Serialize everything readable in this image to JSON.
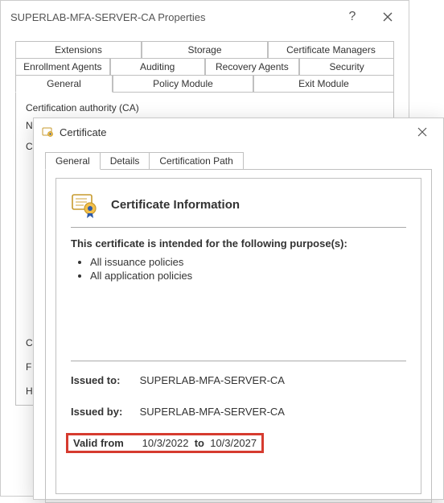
{
  "prop": {
    "title": "SUPERLAB-MFA-SERVER-CA Properties",
    "help": "?",
    "tabs_row1": [
      "Extensions",
      "Storage",
      "Certificate Managers"
    ],
    "tabs_row2": [
      "Enrollment Agents",
      "Auditing",
      "Recovery Agents",
      "Security"
    ],
    "tabs_row3": [
      "General",
      "Policy Module",
      "Exit Module"
    ],
    "ca_label": "Certification authority (CA)",
    "col_label_n": "N",
    "col_label_c": "C",
    "col_label_c2": "C",
    "col_label_f": "F",
    "col_label_h": "H"
  },
  "cert": {
    "title": "Certificate",
    "tabs": [
      "General",
      "Details",
      "Certification Path"
    ],
    "info_title": "Certificate Information",
    "purpose_head": "This certificate is intended for the following purpose(s):",
    "purposes": [
      "All issuance policies",
      "All application policies"
    ],
    "issued_to_label": "Issued to:",
    "issued_to": "SUPERLAB-MFA-SERVER-CA",
    "issued_by_label": "Issued by:",
    "issued_by": "SUPERLAB-MFA-SERVER-CA",
    "valid_from_label": "Valid from",
    "valid_from": "10/3/2022",
    "valid_to_label": "to",
    "valid_to": "10/3/2027"
  }
}
